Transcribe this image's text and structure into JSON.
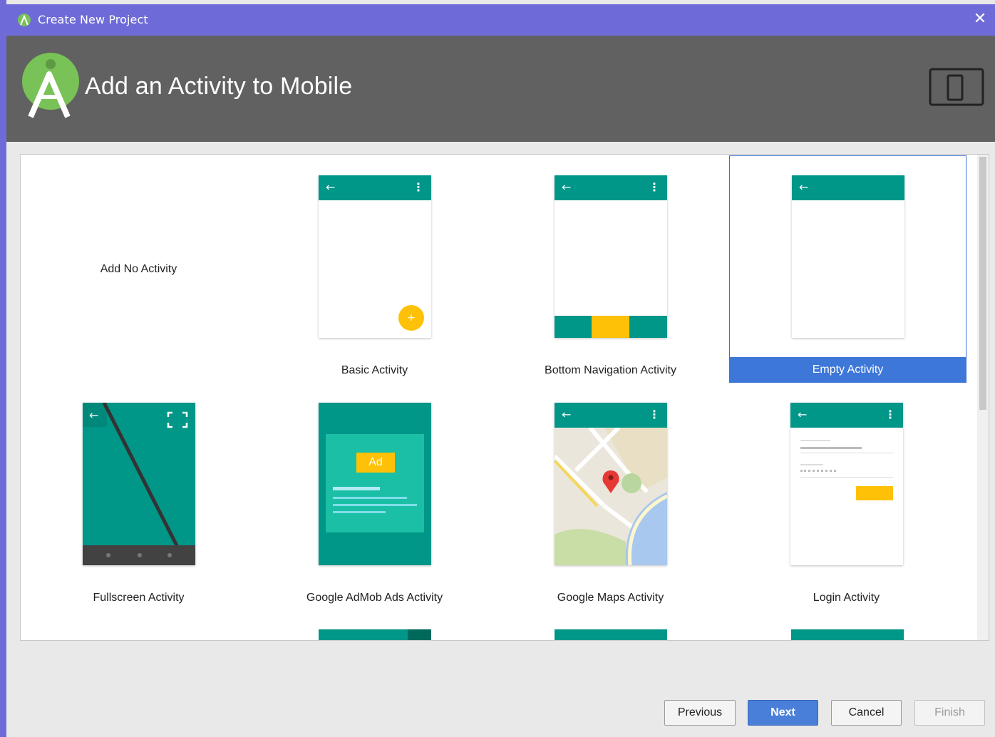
{
  "window": {
    "title": "Create New Project"
  },
  "header": {
    "heading": "Add an Activity to Mobile"
  },
  "tiles": [
    {
      "label": "Add No Activity"
    },
    {
      "label": "Basic Activity"
    },
    {
      "label": "Bottom Navigation Activity"
    },
    {
      "label": "Empty Activity",
      "selected": true
    },
    {
      "label": "Fullscreen Activity"
    },
    {
      "label": "Google AdMob Ads Activity",
      "badge": "Ad"
    },
    {
      "label": "Google Maps Activity"
    },
    {
      "label": "Login Activity"
    }
  ],
  "buttons": {
    "previous": "Previous",
    "next": "Next",
    "cancel": "Cancel",
    "finish": "Finish"
  },
  "colors": {
    "titlebar": "#6e6bd8",
    "header": "#616161",
    "teal": "#009688",
    "selection": "#3d77d8",
    "accent": "#ffc107"
  }
}
